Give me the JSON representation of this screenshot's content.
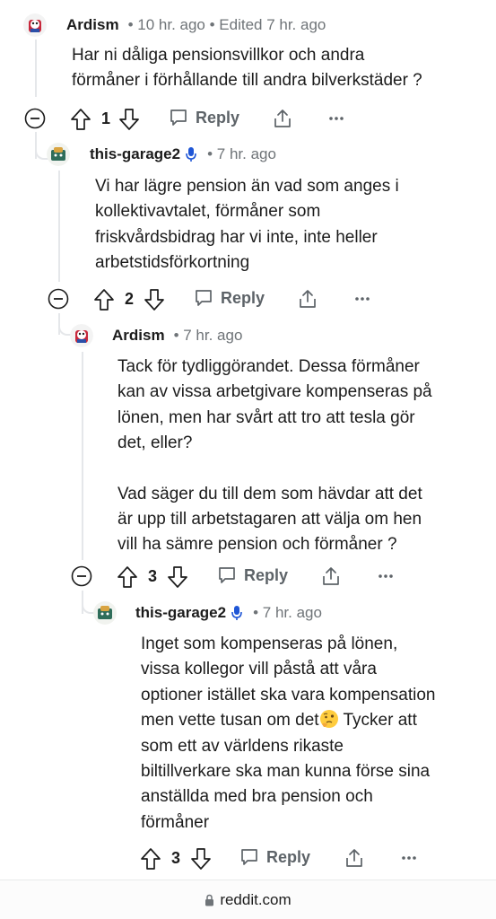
{
  "comments": [
    {
      "username": "Ardism",
      "meta": "• 10 hr. ago • Edited 7 hr. ago",
      "body": [
        "Har ni dåliga pensionsvillkor och andra",
        "förmåner i förhållande till andra bilverkstäder ?"
      ],
      "votes": "1",
      "reply_label": "Reply"
    },
    {
      "username": "this-garage2",
      "meta": "• 7 hr. ago",
      "body": [
        "Vi har lägre pension än vad som anges i",
        "kollektivavtalet, förmåner som",
        "friskvårdsbidrag har vi inte, inte heller",
        "arbetstidsförkortning"
      ],
      "votes": "2",
      "reply_label": "Reply"
    },
    {
      "username": "Ardism",
      "meta": "• 7 hr. ago",
      "body": [
        "Tack för tydliggörandet. Dessa förmåner",
        "kan av vissa arbetgivare kompenseras på",
        "lönen, men har svårt att tro att tesla gör",
        "det, eller?"
      ],
      "body2": [
        "Vad säger du till dem som hävdar att det",
        "är upp till arbetstagaren att välja om hen",
        "vill ha sämre pension och förmåner ?"
      ],
      "votes": "3",
      "reply_label": "Reply"
    },
    {
      "username": "this-garage2",
      "meta": "• 7 hr. ago",
      "body_a": "Inget som kompenseras på lönen,",
      "body_b": "vissa kollegor vill påstå att våra",
      "body_c": "optioner istället ska vara kompensation",
      "body_d1": "men vette tusan om det",
      "body_d2": " Tycker att",
      "body_e": "som ett av världens rikaste",
      "body_f": "biltillverkare ska man kunna förse sina",
      "body_g": "anställda med bra pension och",
      "body_h": "förmåner",
      "votes": "3",
      "reply_label": "Reply"
    }
  ],
  "footer": {
    "url": "reddit.com"
  },
  "colors": {
    "meta": "#6f7478",
    "thread": "#e5e7ea",
    "mic": "#1f56d6"
  },
  "icons": [
    "collapse-icon",
    "upvote-icon",
    "downvote-icon",
    "reply-icon",
    "share-icon",
    "more-icon",
    "lock-icon",
    "microphone-icon"
  ]
}
